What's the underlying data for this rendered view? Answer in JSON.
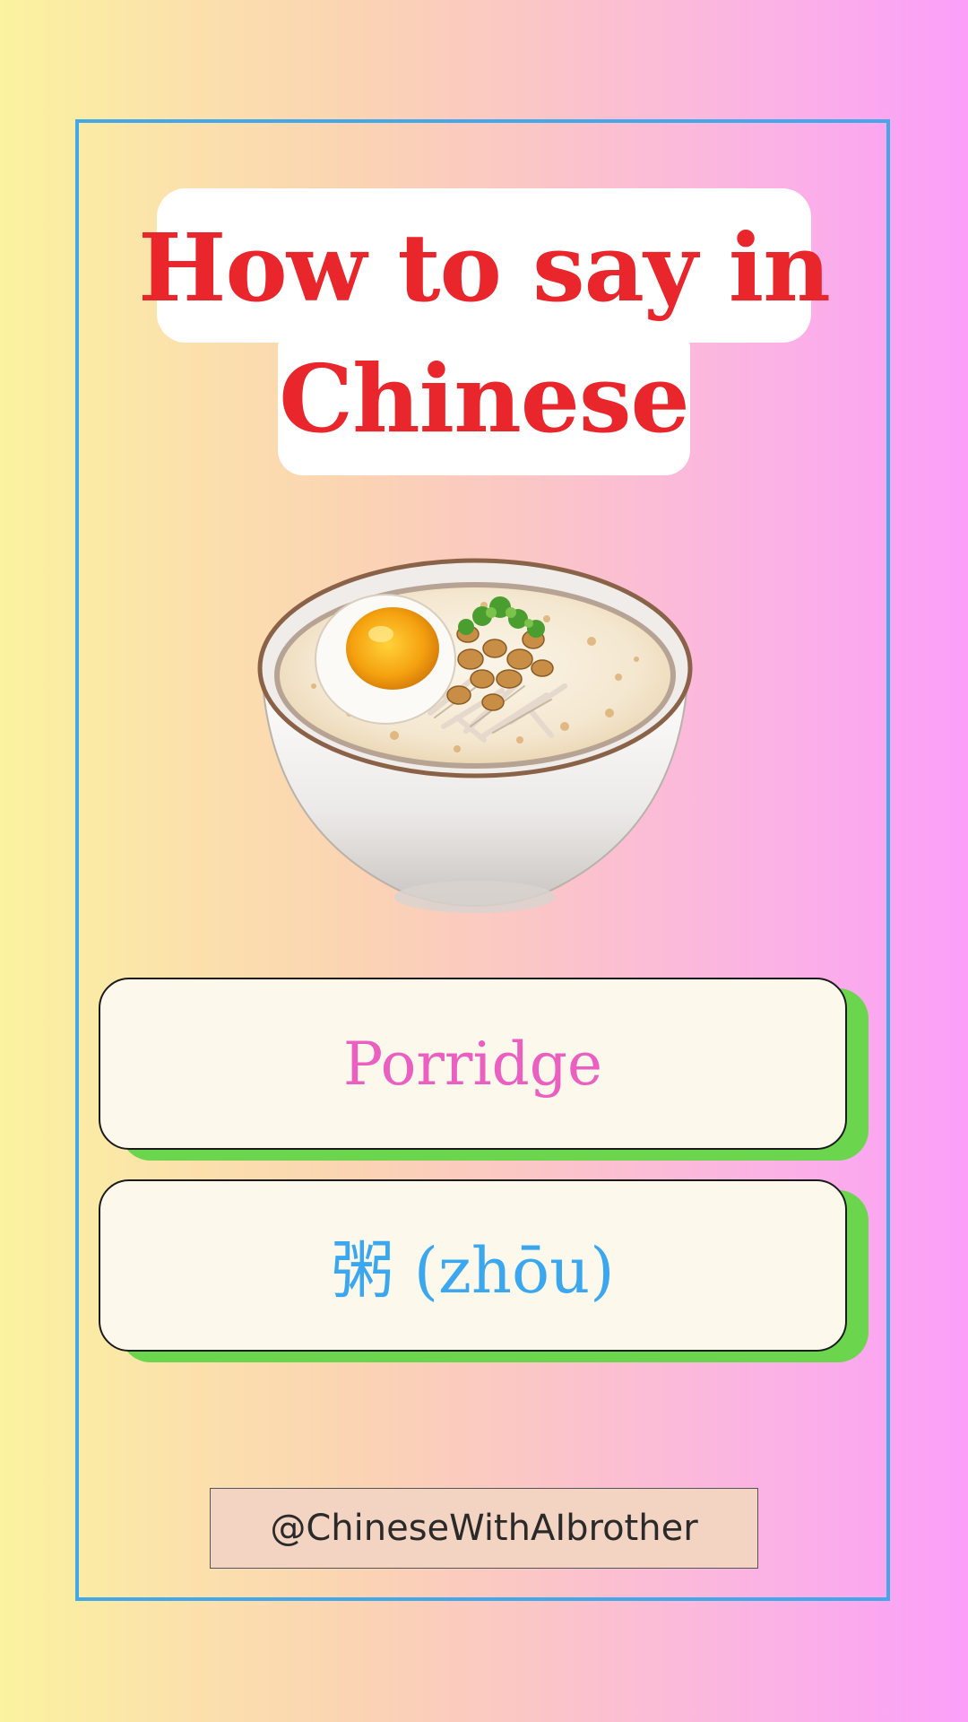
{
  "title": {
    "line1": "How to say in",
    "line2": "Chinese"
  },
  "image": {
    "icon": "porridge-bowl-illustration"
  },
  "cards": {
    "english": "Porridge",
    "chinese": "粥 (zhōu)"
  },
  "footer": {
    "handle": "@ChineseWithAIbrother"
  },
  "colors": {
    "frame": "#43a8ea",
    "title": "#e8262b",
    "english": "#ea5fbf",
    "chinese": "#3ba7ee",
    "card_shadow": "#6bd64d",
    "card_bg": "#fcf9ec"
  }
}
